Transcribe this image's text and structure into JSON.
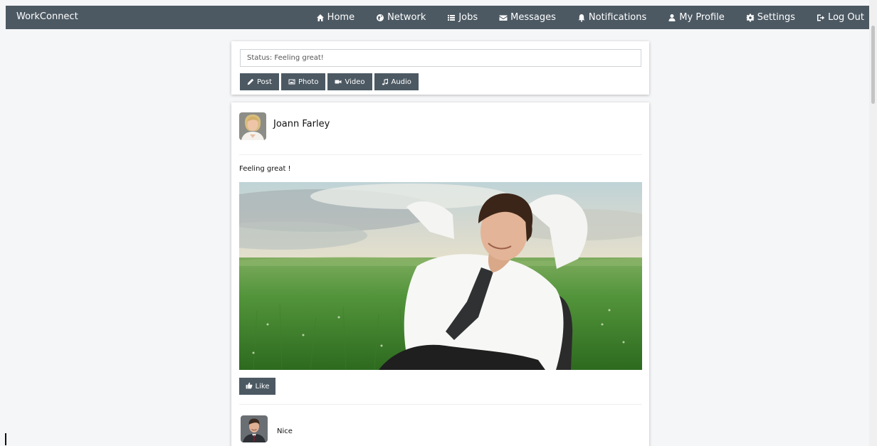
{
  "app": {
    "title": "WorkConnect"
  },
  "nav": {
    "items": [
      {
        "label": "Home",
        "icon": "home-icon"
      },
      {
        "label": "Network",
        "icon": "globe-icon"
      },
      {
        "label": "Jobs",
        "icon": "list-icon"
      },
      {
        "label": "Messages",
        "icon": "envelope-icon"
      },
      {
        "label": "Notifications",
        "icon": "bell-icon"
      },
      {
        "label": "My Profile",
        "icon": "user-icon"
      },
      {
        "label": "Settings",
        "icon": "gear-icon"
      },
      {
        "label": "Log Out",
        "icon": "logout-icon"
      }
    ]
  },
  "composer": {
    "status_value": "Status: Feeling great!",
    "buttons": [
      {
        "label": "Post",
        "icon": "pencil-icon"
      },
      {
        "label": "Photo",
        "icon": "image-icon"
      },
      {
        "label": "Video",
        "icon": "video-icon"
      },
      {
        "label": "Audio",
        "icon": "music-icon"
      }
    ]
  },
  "post": {
    "author": "Joann Farley",
    "text": "Feeling great !",
    "like_label": "Like",
    "comments": [
      {
        "text": "Nice"
      }
    ]
  },
  "colors": {
    "navbar": "#4c5963",
    "button": "#4c5963",
    "background": "#f5f6f8",
    "card": "#ffffff"
  }
}
